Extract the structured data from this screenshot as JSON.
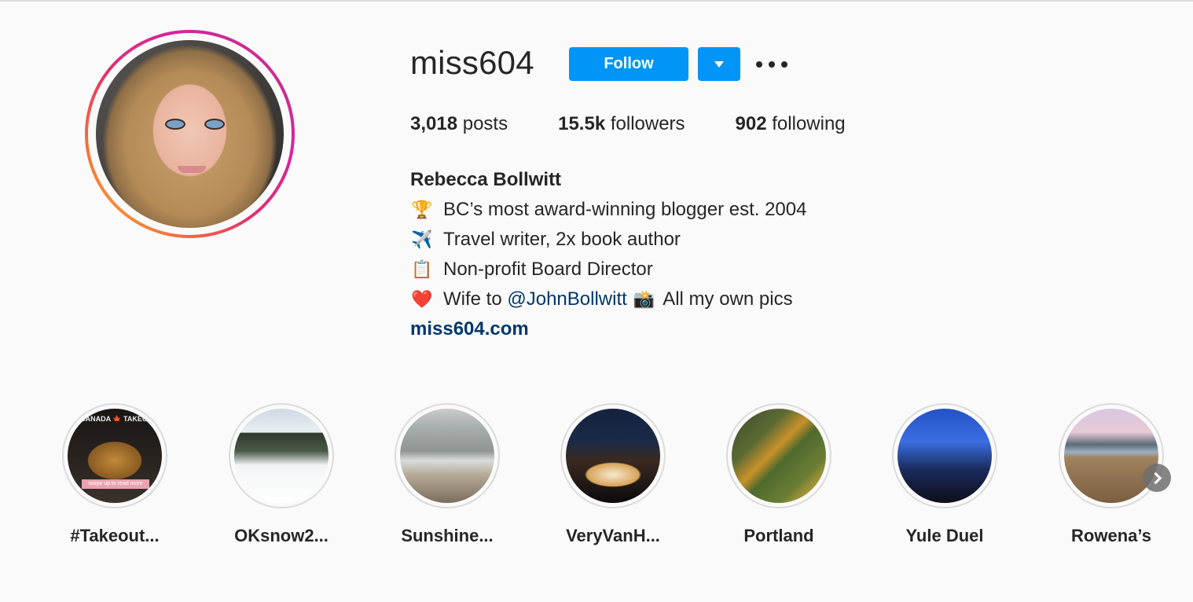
{
  "profile": {
    "username": "miss604",
    "follow_label": "Follow",
    "dropdown_icon": "triangle-down-icon",
    "more_icon": "ellipsis-icon",
    "accent_color": "#0095f6",
    "story_ring_colors": [
      "#c13584",
      "#e1306c",
      "#f77737"
    ]
  },
  "stats": {
    "posts": {
      "value": "3,018",
      "label": "posts"
    },
    "followers": {
      "value": "15.5k",
      "label": "followers"
    },
    "following": {
      "value": "902",
      "label": "following"
    }
  },
  "bio": {
    "full_name": "Rebecca Bollwitt",
    "lines": [
      {
        "emoji": "🏆",
        "text": "BC’s most award-winning blogger est. 2004"
      },
      {
        "emoji": "✈️",
        "text": "Travel writer, 2x book author"
      },
      {
        "emoji": "📋",
        "text": "Non-profit Board Director"
      },
      {
        "emoji": "❤️",
        "text_before": "Wife to ",
        "mention": "@JohnBollwitt",
        "emoji2": "📸",
        "text_after": "All my own pics"
      }
    ],
    "website": "miss604.com",
    "link_color": "#00376b"
  },
  "highlights": [
    {
      "label": "#Takeout...",
      "sign_text": "CANADA 🍁 TAKEOUT",
      "overlay_text": "swipe up to read more"
    },
    {
      "label": "OKsnow2..."
    },
    {
      "label": "Sunshine..."
    },
    {
      "label": "VeryVanH..."
    },
    {
      "label": "Portland"
    },
    {
      "label": "Yule Duel"
    },
    {
      "label": "Rowena’s"
    }
  ],
  "highlights_next_icon": "chevron-right-icon"
}
